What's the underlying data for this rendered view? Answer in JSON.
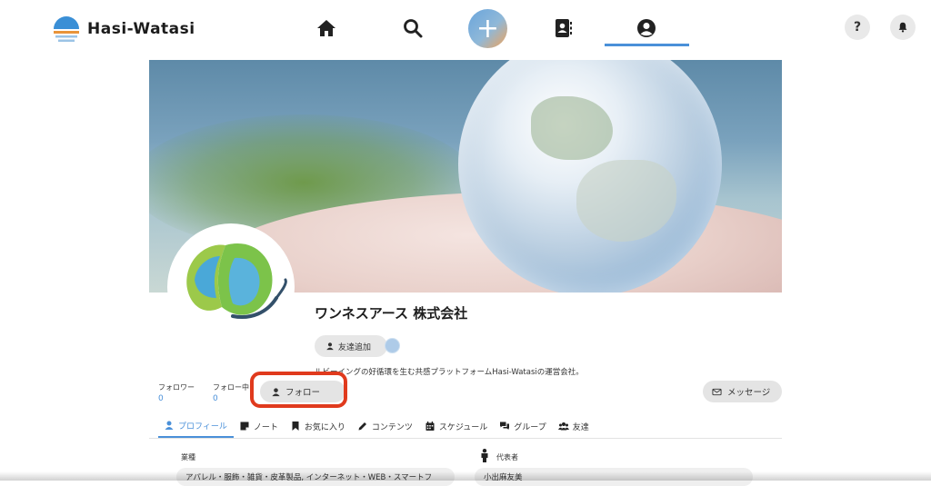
{
  "brand": {
    "name": "Hasi-Watasi"
  },
  "nav": {
    "items": [
      {
        "name": "home",
        "icon": "home-icon"
      },
      {
        "name": "search",
        "icon": "search-icon"
      },
      {
        "name": "create",
        "icon": "plus-icon",
        "label": "+"
      },
      {
        "name": "contacts",
        "icon": "contacts-icon"
      },
      {
        "name": "profile",
        "icon": "user-circle-icon",
        "active": true
      }
    ],
    "help_label": "?",
    "accent": "#4a90d9"
  },
  "profile": {
    "company_name": "ワンネスアース 株式会社",
    "friend_button": "友達追加",
    "description": "ルビーイングの好循環を生む共感プラットフォームHasi-Watasiの運営会社。",
    "followers_label": "フォロワー",
    "followers_count": "0",
    "following_label": "フォロー中",
    "following_count": "0",
    "follow_button": "フォロー",
    "message_button": "メッセージ"
  },
  "tabs": [
    {
      "label": "プロフィール",
      "icon": "user-icon",
      "active": true
    },
    {
      "label": "ノート",
      "icon": "note-icon"
    },
    {
      "label": "お気に入り",
      "icon": "bookmark-icon"
    },
    {
      "label": "コンテンツ",
      "icon": "pen-icon"
    },
    {
      "label": "スケジュール",
      "icon": "calendar-icon"
    },
    {
      "label": "グループ",
      "icon": "chat-icon"
    },
    {
      "label": "友達",
      "icon": "users-icon"
    }
  ],
  "info": {
    "industry_label": "業種",
    "industry_value": "アパレル・服飾・雑貨・皮革製品, インターネット・WEB・スマートフ",
    "rep_label": "代表者",
    "rep_value": "小出麻友美"
  }
}
